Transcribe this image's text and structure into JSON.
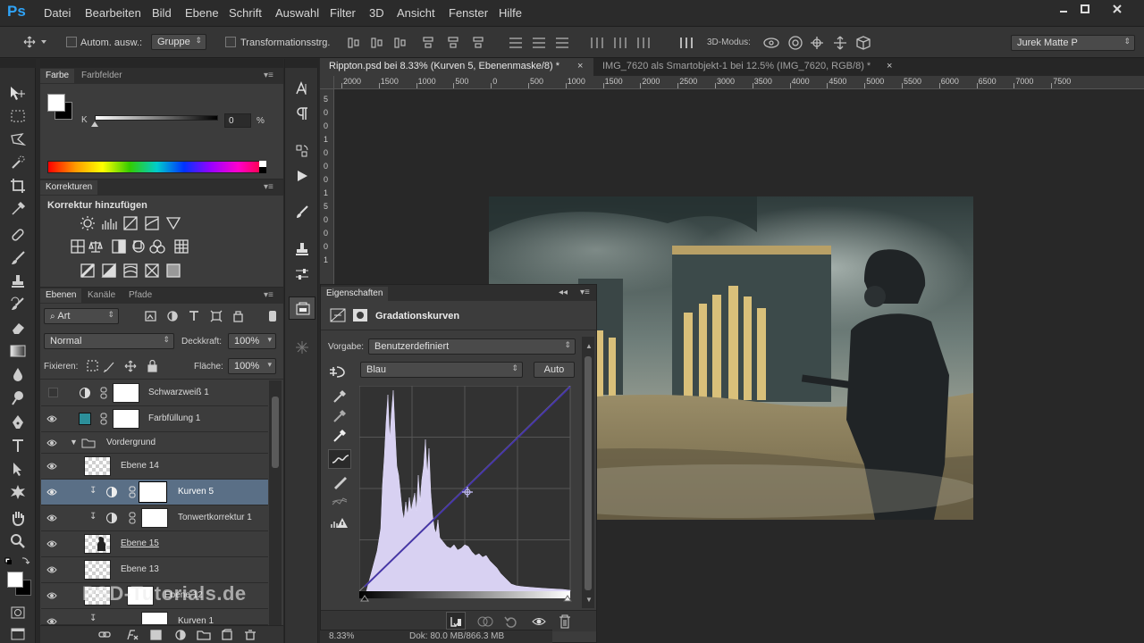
{
  "app": {
    "logo": "Ps"
  },
  "menu": [
    "Datei",
    "Bearbeiten",
    "Bild",
    "Ebene",
    "Schrift",
    "Auswahl",
    "Filter",
    "3D",
    "Ansicht",
    "Fenster",
    "Hilfe"
  ],
  "options_bar": {
    "auto_select_label": "Autom. ausw.:",
    "auto_select_value": "Gruppe",
    "transform_label": "Transformationsstrg.",
    "mode_3d_label": "3D-Modus:",
    "workspace_value": "Jurek Matte P"
  },
  "color_panel": {
    "tabs": [
      "Farbe",
      "Farbfelder"
    ],
    "channel_label": "K",
    "value": "0",
    "unit": "%"
  },
  "adjustments_panel": {
    "tab": "Korrekturen",
    "heading": "Korrektur hinzufügen"
  },
  "layers_panel": {
    "tabs": [
      "Ebenen",
      "Kanäle",
      "Pfade"
    ],
    "filter_value": "Art",
    "blend_mode": "Normal",
    "opacity_label": "Deckkraft:",
    "opacity_value": "100%",
    "lock_label": "Fixieren:",
    "fill_label": "Fläche:",
    "fill_value": "100%",
    "layers": [
      {
        "name": "Schwarzweiß 1"
      },
      {
        "name": "Farbfüllung 1"
      },
      {
        "name": "Vordergrund"
      },
      {
        "name": "Ebene 14"
      },
      {
        "name": "Kurven 5"
      },
      {
        "name": "Tonwertkorrektur 1"
      },
      {
        "name": "Ebene 15"
      },
      {
        "name": "Ebene 13"
      },
      {
        "name": "Ebene 12"
      },
      {
        "name": "Kurven 1"
      }
    ]
  },
  "documents": {
    "tabs": [
      "Rippton.psd bei 8.33% (Kurven 5, Ebenenmaske/8) *",
      "IMG_7620 als Smartobjekt-1 bei 12.5% (IMG_7620, RGB/8) *"
    ]
  },
  "ruler": {
    "h_labels": [
      "2000",
      "1500",
      "1000",
      "500",
      "0",
      "500",
      "1000",
      "1500",
      "2000",
      "2500",
      "3000",
      "3500",
      "4000",
      "4500",
      "5000",
      "5500",
      "6000",
      "6500",
      "7000",
      "7500"
    ],
    "v_labels": [
      "5",
      "0",
      "0",
      "1",
      "0",
      "0",
      "0",
      "1",
      "5",
      "0",
      "0",
      "0",
      "1"
    ]
  },
  "properties_panel": {
    "tab": "Eigenschaften",
    "title": "Gradationskurven",
    "preset_label": "Vorgabe:",
    "preset_value": "Benutzerdefiniert",
    "channel_value": "Blau",
    "auto_button": "Auto"
  },
  "status": {
    "zoom": "8.33%",
    "doc": "Dok: 80.0 MB/866.3 MB"
  },
  "watermark": "PSD-Tutorials.de",
  "colors": {
    "accent": "#2fa3f7",
    "selected_layer": "#5a6f86",
    "curve_line": "#4433aa",
    "histogram": "#d8d1f2"
  }
}
